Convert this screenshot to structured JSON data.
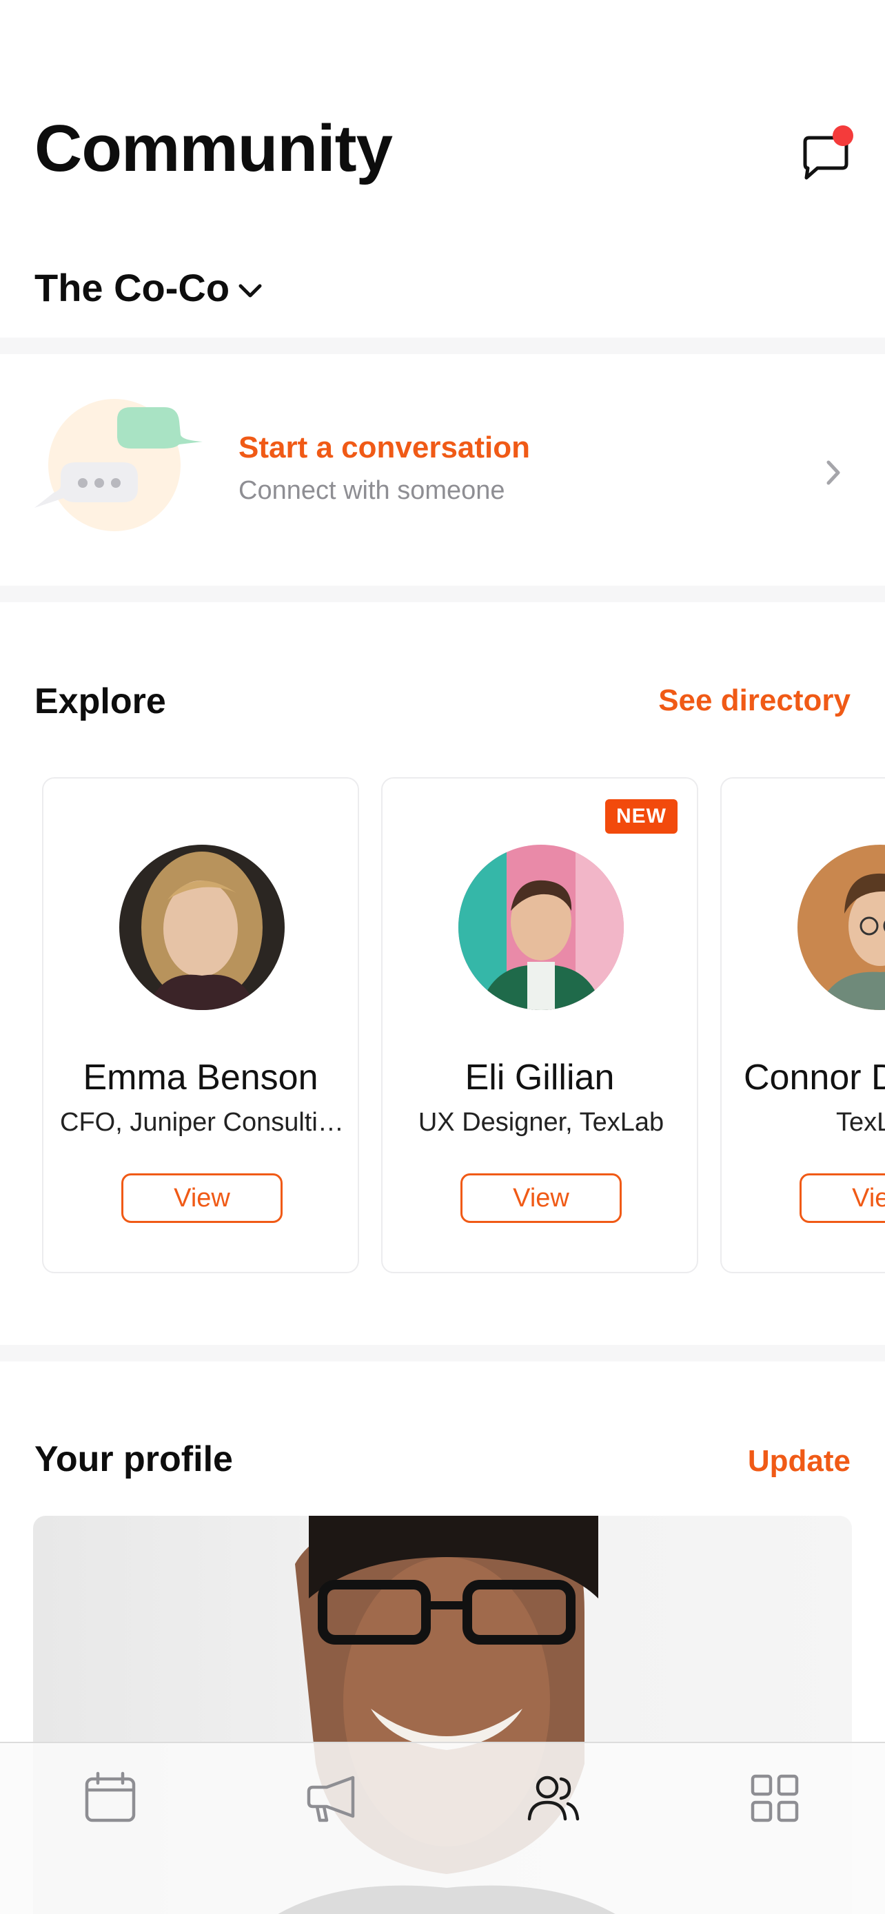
{
  "header": {
    "title": "Community",
    "community_name": "The Co-Co"
  },
  "conversation": {
    "title": "Start a conversation",
    "subtitle": "Connect with someone"
  },
  "explore": {
    "title": "Explore",
    "link": "See directory",
    "members": [
      {
        "name": "Emma Benson",
        "role": "CFO, Juniper Consulting",
        "button": "View",
        "badge": ""
      },
      {
        "name": "Eli Gillian",
        "role": "UX Designer, TexLab",
        "button": "View",
        "badge": "NEW"
      },
      {
        "name": "Connor D",
        "role": "TexL",
        "button": "View",
        "badge": ""
      }
    ]
  },
  "profile": {
    "title": "Your profile",
    "link": "Update"
  },
  "tabbar": {
    "tabs": [
      {
        "icon": "calendar-icon",
        "active": false
      },
      {
        "icon": "megaphone-icon",
        "active": false
      },
      {
        "icon": "people-icon",
        "active": true
      },
      {
        "icon": "grid-icon",
        "active": false
      }
    ]
  },
  "colors": {
    "accent": "#f05a16",
    "notification": "#f43b3b",
    "badge": "#f24a0c"
  }
}
